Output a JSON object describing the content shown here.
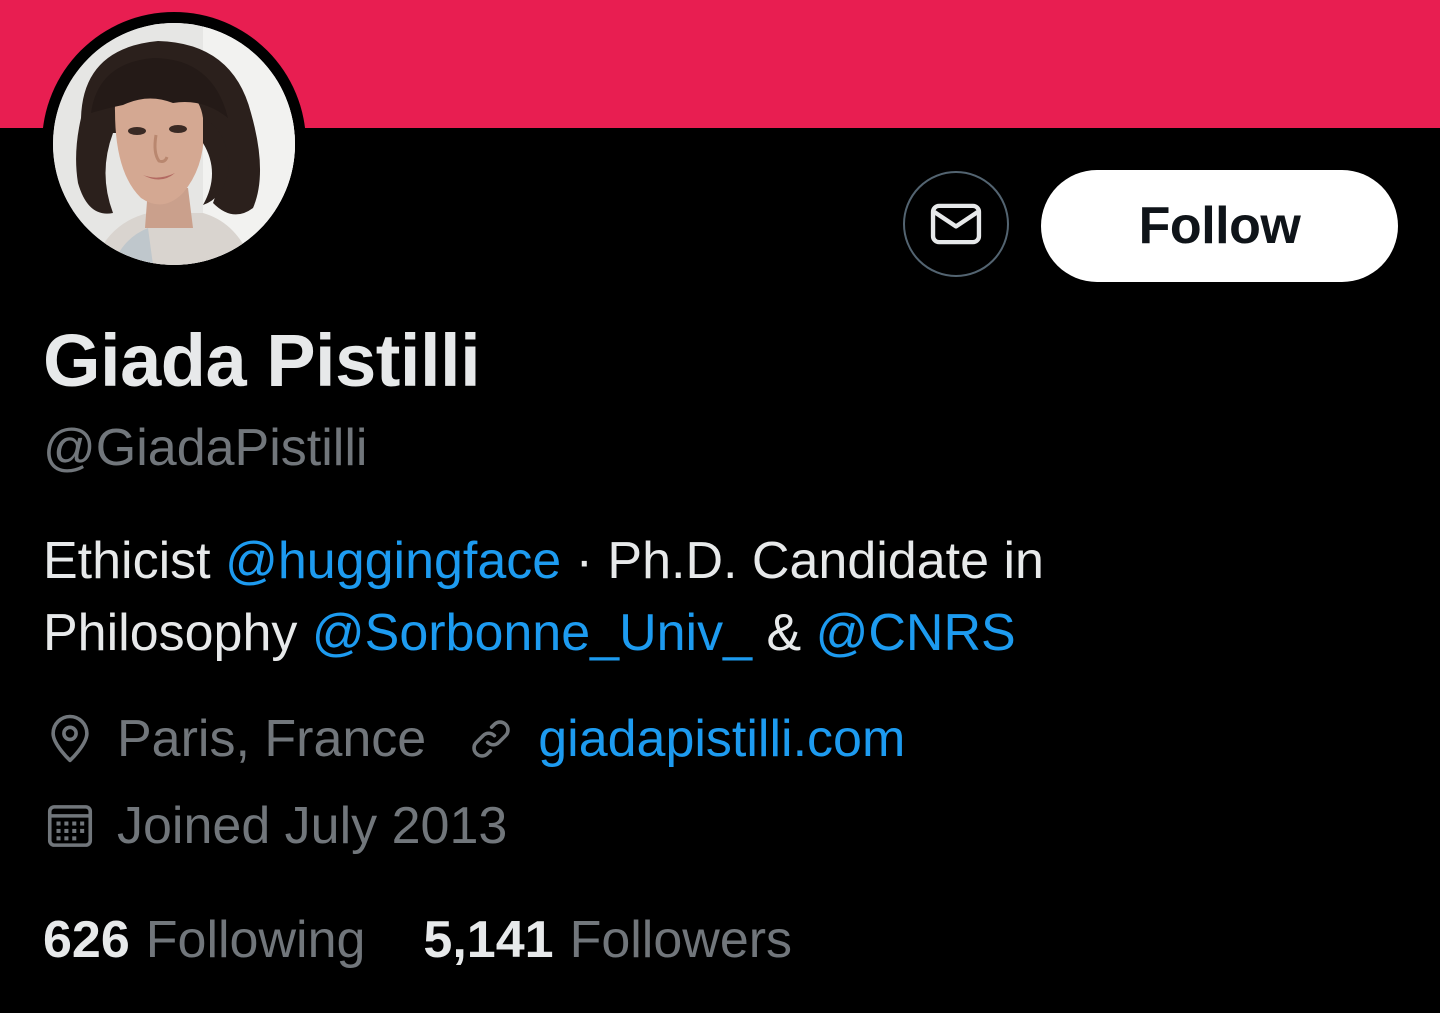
{
  "profile": {
    "banner_color": "#e81e51",
    "avatar_alt": "Profile photo",
    "name": "Giada Pistilli",
    "handle": "@GiadaPistilli",
    "bio": {
      "t1": "Ethicist ",
      "m1": "@huggingface",
      "t2": " · Ph.D. Candidate in Philosophy ",
      "m2": "@Sorbonne_Univ_",
      "t3": " & ",
      "m3": "@CNRS"
    },
    "location": "Paris, France",
    "website": "giadapistilli.com",
    "joined": "Joined July 2013"
  },
  "actions": {
    "message_icon": "envelope-icon",
    "follow_label": "Follow"
  },
  "stats": {
    "following_count": "626",
    "following_label": "Following",
    "followers_count": "5,141",
    "followers_label": "Followers"
  },
  "colors": {
    "background": "#000000",
    "accent": "#1d9bf0",
    "primary_text": "#e7e9ea",
    "secondary_text": "#71767b"
  }
}
